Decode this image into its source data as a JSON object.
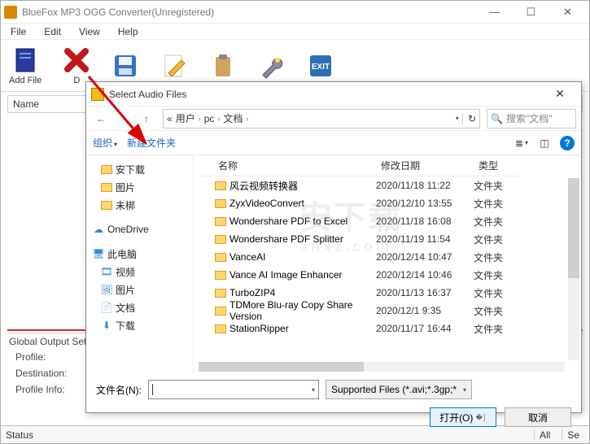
{
  "main": {
    "title": "BlueFox MP3 OGG Converter(Unregistered)",
    "menu": {
      "file": "File",
      "edit": "Edit",
      "view": "View",
      "help": "Help"
    },
    "toolbar": {
      "add_file": "Add File",
      "delete": "D"
    },
    "list_header": "Name",
    "settings": {
      "header": "Global Output Setti",
      "profile": "Profile:",
      "destination": "Destination:",
      "profile_info": "Profile Info:"
    },
    "statusbar": {
      "label": "Status",
      "all": "All",
      "se": "Se"
    }
  },
  "dialog": {
    "title": "Select Audio Files",
    "breadcrumb": {
      "b1": "«",
      "b2": "用户",
      "b3": "pc",
      "b4": "文档"
    },
    "search_placeholder": "搜索\"文档\"",
    "organize": "组织",
    "new_folder": "新建文件夹",
    "columns": {
      "name": "名称",
      "date": "修改日期",
      "type": "类型"
    },
    "tree": {
      "downloads_cn": "安下载",
      "pictures": "图片",
      "uncat": "未梆",
      "onedrive": "OneDrive",
      "thispc": "此电脑",
      "videos": "视频",
      "pictures2": "图片",
      "documents": "文档",
      "downloads": "下载"
    },
    "files": [
      {
        "name": "风云视频转换器",
        "date": "2020/11/18 11:22",
        "type": "文件夹"
      },
      {
        "name": "ZyxVideoConvert",
        "date": "2020/12/10 13:55",
        "type": "文件夹"
      },
      {
        "name": "Wondershare PDF to Excel",
        "date": "2020/11/18 16:08",
        "type": "文件夹"
      },
      {
        "name": "Wondershare PDF Splitter",
        "date": "2020/11/19 11:54",
        "type": "文件夹"
      },
      {
        "name": "VanceAI",
        "date": "2020/12/14 10:47",
        "type": "文件夹"
      },
      {
        "name": "Vance AI Image Enhancer",
        "date": "2020/12/14 10:46",
        "type": "文件夹"
      },
      {
        "name": "TurboZIP4",
        "date": "2020/11/13 16:37",
        "type": "文件夹"
      },
      {
        "name": "TDMore Blu-ray Copy Share Version",
        "date": "2020/12/1 9:35",
        "type": "文件夹"
      },
      {
        "name": "StationRipper",
        "date": "2020/11/17 16:44",
        "type": "文件夹"
      }
    ],
    "filename_label": "文件名(N):",
    "filetype_label": "Supported Files (*.avi;*.3gp;*",
    "open_btn": "打开(O)",
    "cancel_btn": "取消",
    "help": "?"
  }
}
